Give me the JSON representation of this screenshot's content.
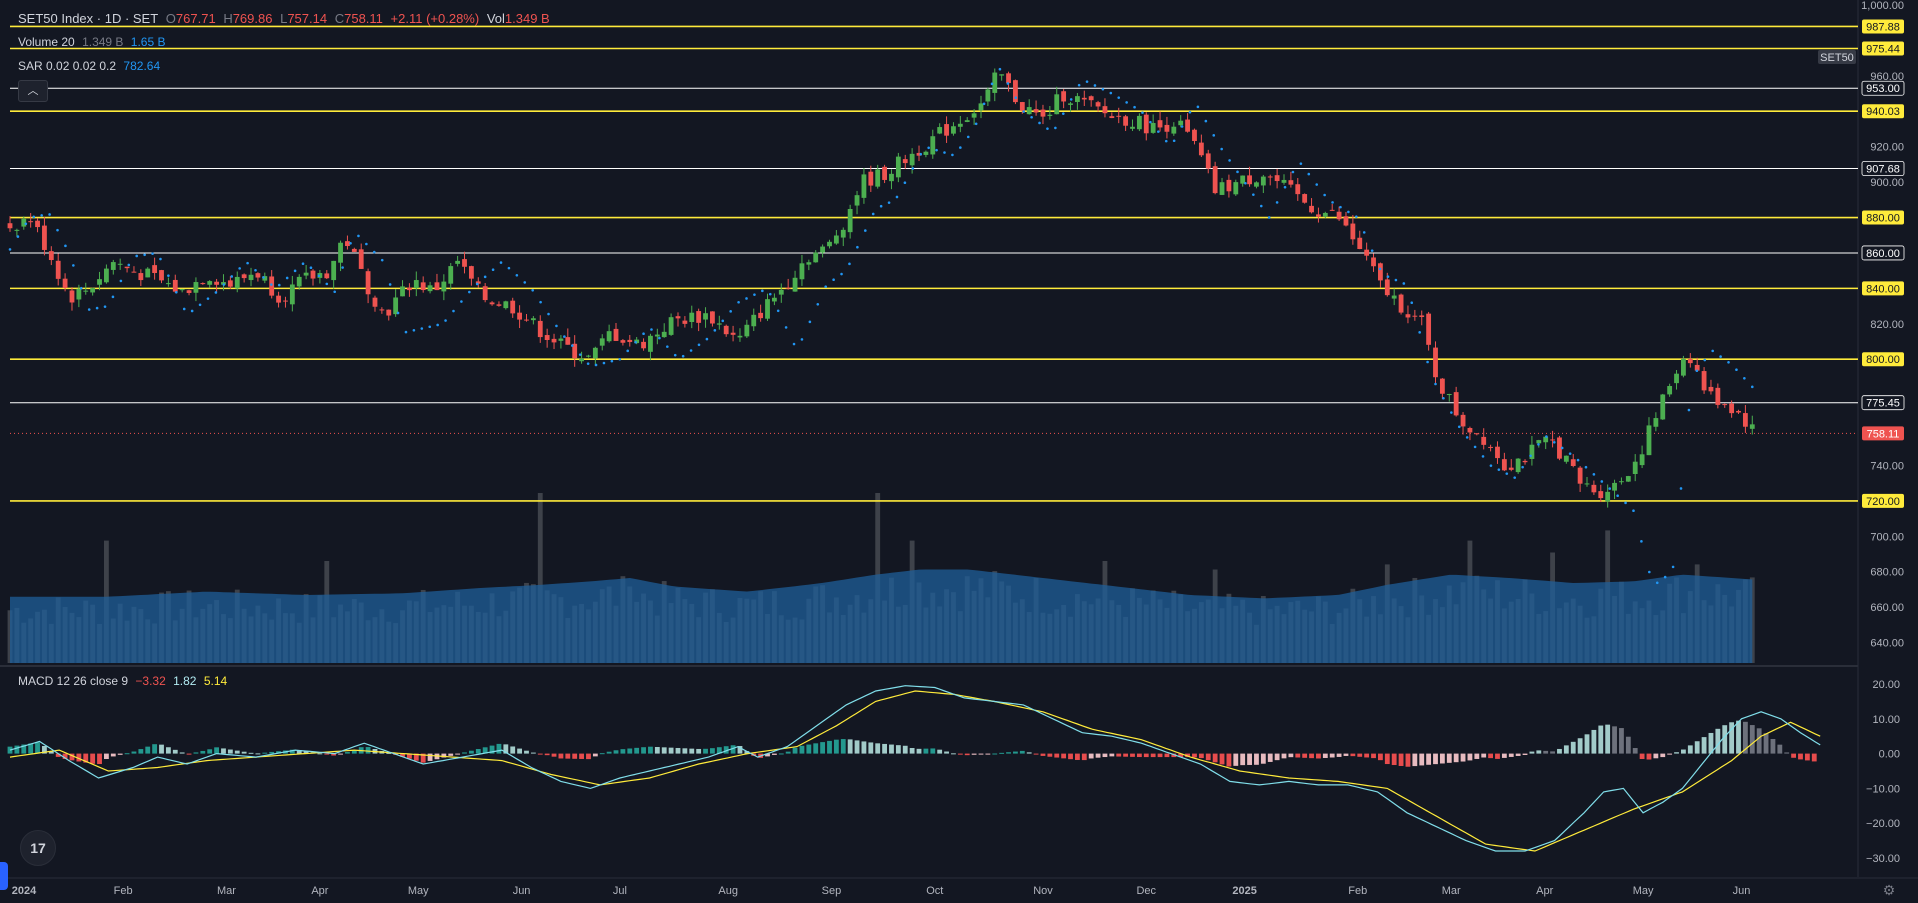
{
  "legend": {
    "symbol": "SET50 Index · 1D · SET",
    "o_label": "O",
    "o_value": "767.71",
    "h_label": "H",
    "h_value": "769.86",
    "l_label": "L",
    "l_value": "757.14",
    "c_label": "C",
    "c_value": "758.11",
    "change": "+2.11 (+0.28%)",
    "vol_label": "Vol",
    "vol_value": "1.349 B"
  },
  "volume_legend": {
    "label": "Volume 20",
    "value1": "1.349 B",
    "value2": "1.65 B"
  },
  "sar_legend": {
    "label": "SAR 0.02 0.02 0.2",
    "value": "782.64"
  },
  "macd_legend": {
    "label": "MACD 12 26 close 9",
    "v1": "−3.32",
    "v2": "1.82",
    "v3": "5.14"
  },
  "symbol_badge": "SET50",
  "icons": {
    "collapse": "chevron-up-icon",
    "logo": "tradingview-logo-icon",
    "settings": "gear-icon"
  },
  "colors": {
    "background": "#131722",
    "up": "#4caf50",
    "down": "#ef5350",
    "sar": "#2196f3",
    "volume_up": "#5d606b",
    "volume_ma": "#1f5f99",
    "macd_line": "#80deea",
    "signal_line": "#ffeb3b",
    "hline_yellow": "#ffeb3b",
    "hline_white": "#ffffff"
  },
  "chart_data": {
    "type": "candlestick",
    "price_axis": {
      "ticks": [
        "1,000.00",
        "960.00",
        "920.00",
        "900.00",
        "820.00",
        "740.00",
        "700.00",
        "680.00",
        "660.00",
        "640.00"
      ],
      "tick_values": [
        1000,
        960,
        920,
        900,
        820,
        740,
        700,
        680,
        660,
        640
      ]
    },
    "macd_axis": {
      "ticks": [
        "20.00",
        "10.00",
        "0.00",
        "−10.00",
        "−20.00",
        "−30.00"
      ],
      "tick_values": [
        20,
        10,
        0,
        -10,
        -20,
        -30
      ]
    },
    "horizontal_lines": [
      {
        "value": 987.88,
        "label": "987.88",
        "color": "yellow"
      },
      {
        "value": 975.44,
        "label": "975.44",
        "color": "yellow"
      },
      {
        "value": 953.0,
        "label": "953.00",
        "color": "white"
      },
      {
        "value": 940.03,
        "label": "940.03",
        "color": "yellow"
      },
      {
        "value": 907.68,
        "label": "907.68",
        "color": "white"
      },
      {
        "value": 880.0,
        "label": "880.00",
        "color": "yellow"
      },
      {
        "value": 860.0,
        "label": "860.00",
        "color": "white"
      },
      {
        "value": 840.0,
        "label": "840.00",
        "color": "yellow"
      },
      {
        "value": 800.0,
        "label": "800.00",
        "color": "yellow"
      },
      {
        "value": 775.45,
        "label": "775.45",
        "color": "white"
      },
      {
        "value": 720.0,
        "label": "720.00",
        "color": "yellow"
      }
    ],
    "last_price": {
      "value": 758.11,
      "label": "758.11"
    },
    "x_labels": [
      "2024",
      "Feb",
      "Mar",
      "Apr",
      "May",
      "Jun",
      "Jul",
      "Aug",
      "Sep",
      "Oct",
      "Nov",
      "Dec",
      "2025",
      "Feb",
      "Mar",
      "Apr",
      "May",
      "Jun"
    ],
    "x_label_days": [
      0,
      23,
      44,
      63,
      83,
      104,
      124,
      146,
      167,
      188,
      210,
      231,
      251,
      274,
      293,
      312,
      332,
      352
    ],
    "close_keypoints": [
      [
        0,
        875
      ],
      [
        4,
        880
      ],
      [
        8,
        860
      ],
      [
        12,
        835
      ],
      [
        16,
        840
      ],
      [
        21,
        855
      ],
      [
        25,
        850
      ],
      [
        30,
        845
      ],
      [
        35,
        838
      ],
      [
        40,
        848
      ],
      [
        45,
        842
      ],
      [
        50,
        850
      ],
      [
        55,
        835
      ],
      [
        60,
        845
      ],
      [
        65,
        850
      ],
      [
        68,
        870
      ],
      [
        72,
        845
      ],
      [
        76,
        825
      ],
      [
        82,
        845
      ],
      [
        86,
        838
      ],
      [
        91,
        855
      ],
      [
        96,
        835
      ],
      [
        102,
        830
      ],
      [
        107,
        818
      ],
      [
        112,
        808
      ],
      [
        118,
        800
      ],
      [
        122,
        815
      ],
      [
        128,
        808
      ],
      [
        135,
        822
      ],
      [
        142,
        825
      ],
      [
        148,
        810
      ],
      [
        152,
        825
      ],
      [
        157,
        840
      ],
      [
        162,
        858
      ],
      [
        166,
        862
      ],
      [
        170,
        880
      ],
      [
        173,
        900
      ],
      [
        178,
        905
      ],
      [
        183,
        915
      ],
      [
        188,
        925
      ],
      [
        193,
        935
      ],
      [
        198,
        945
      ],
      [
        201,
        962
      ],
      [
        205,
        945
      ],
      [
        210,
        935
      ],
      [
        214,
        950
      ],
      [
        218,
        945
      ],
      [
        223,
        938
      ],
      [
        228,
        935
      ],
      [
        233,
        930
      ],
      [
        237,
        935
      ],
      [
        241,
        920
      ],
      [
        245,
        895
      ],
      [
        250,
        900
      ],
      [
        255,
        905
      ],
      [
        260,
        895
      ],
      [
        265,
        885
      ],
      [
        270,
        880
      ],
      [
        275,
        860
      ],
      [
        279,
        840
      ],
      [
        283,
        830
      ],
      [
        287,
        820
      ],
      [
        290,
        790
      ],
      [
        295,
        765
      ],
      [
        300,
        755
      ],
      [
        304,
        740
      ],
      [
        308,
        745
      ],
      [
        313,
        755
      ],
      [
        316,
        745
      ],
      [
        319,
        730
      ],
      [
        323,
        725
      ],
      [
        327,
        730
      ],
      [
        331,
        745
      ],
      [
        335,
        770
      ],
      [
        338,
        790
      ],
      [
        341,
        805
      ],
      [
        345,
        780
      ],
      [
        349,
        775
      ],
      [
        352,
        768
      ],
      [
        355,
        758
      ]
    ],
    "sar_keypoints": [
      [
        0,
        862
      ],
      [
        4,
        880
      ],
      [
        8,
        882
      ],
      [
        12,
        860
      ],
      [
        16,
        828
      ],
      [
        20,
        830
      ],
      [
        25,
        858
      ],
      [
        30,
        860
      ],
      [
        36,
        825
      ],
      [
        42,
        838
      ],
      [
        48,
        855
      ],
      [
        54,
        840
      ],
      [
        60,
        855
      ],
      [
        66,
        838
      ],
      [
        70,
        872
      ],
      [
        76,
        855
      ],
      [
        80,
        815
      ],
      [
        88,
        820
      ],
      [
        94,
        840
      ],
      [
        100,
        855
      ],
      [
        106,
        840
      ],
      [
        112,
        815
      ],
      [
        118,
        796
      ],
      [
        124,
        800
      ],
      [
        130,
        818
      ],
      [
        136,
        800
      ],
      [
        142,
        812
      ],
      [
        148,
        832
      ],
      [
        154,
        840
      ],
      [
        160,
        805
      ],
      [
        166,
        842
      ],
      [
        170,
        850
      ],
      [
        176,
        885
      ],
      [
        180,
        890
      ],
      [
        186,
        920
      ],
      [
        192,
        915
      ],
      [
        196,
        930
      ],
      [
        201,
        965
      ],
      [
        206,
        940
      ],
      [
        212,
        928
      ],
      [
        218,
        958
      ],
      [
        224,
        950
      ],
      [
        230,
        940
      ],
      [
        236,
        920
      ],
      [
        241,
        945
      ],
      [
        246,
        920
      ],
      [
        251,
        900
      ],
      [
        256,
        880
      ],
      [
        262,
        912
      ],
      [
        268,
        890
      ],
      [
        274,
        880
      ],
      [
        279,
        848
      ],
      [
        284,
        842
      ],
      [
        289,
        790
      ],
      [
        295,
        760
      ],
      [
        301,
        740
      ],
      [
        306,
        733
      ],
      [
        312,
        757
      ],
      [
        318,
        745
      ],
      [
        324,
        730
      ],
      [
        330,
        715
      ],
      [
        334,
        672
      ],
      [
        338,
        680
      ],
      [
        342,
        790
      ],
      [
        346,
        805
      ],
      [
        350,
        797
      ],
      [
        355,
        782
      ]
    ],
    "volume_ma_keypoints": [
      [
        0,
        0.39
      ],
      [
        20,
        0.39
      ],
      [
        40,
        0.42
      ],
      [
        60,
        0.4
      ],
      [
        80,
        0.41
      ],
      [
        95,
        0.44
      ],
      [
        108,
        0.46
      ],
      [
        118,
        0.48
      ],
      [
        126,
        0.5
      ],
      [
        135,
        0.45
      ],
      [
        150,
        0.42
      ],
      [
        165,
        0.47
      ],
      [
        176,
        0.52
      ],
      [
        185,
        0.55
      ],
      [
        195,
        0.55
      ],
      [
        210,
        0.5
      ],
      [
        225,
        0.45
      ],
      [
        240,
        0.4
      ],
      [
        255,
        0.38
      ],
      [
        270,
        0.4
      ],
      [
        280,
        0.46
      ],
      [
        293,
        0.52
      ],
      [
        305,
        0.5
      ],
      [
        318,
        0.47
      ],
      [
        330,
        0.48
      ],
      [
        340,
        0.52
      ],
      [
        350,
        0.5
      ],
      [
        355,
        0.49
      ]
    ],
    "volume_spikes": [
      [
        19,
        0.72
      ],
      [
        65,
        0.6
      ],
      [
        108,
        1.0
      ],
      [
        126,
        0.45
      ],
      [
        176,
        1.0
      ],
      [
        183,
        0.72
      ],
      [
        222,
        0.6
      ],
      [
        245,
        0.55
      ],
      [
        280,
        0.58
      ],
      [
        297,
        0.72
      ],
      [
        313,
        0.65
      ],
      [
        325,
        0.78
      ],
      [
        343,
        0.58
      ]
    ],
    "macd_keypoints": [
      [
        0,
        1
      ],
      [
        6,
        3.5
      ],
      [
        12,
        -2
      ],
      [
        18,
        -7
      ],
      [
        25,
        -4
      ],
      [
        30,
        -1
      ],
      [
        36,
        -3
      ],
      [
        42,
        0
      ],
      [
        50,
        -1
      ],
      [
        58,
        1
      ],
      [
        66,
        0
      ],
      [
        72,
        3
      ],
      [
        78,
        0
      ],
      [
        84,
        -3
      ],
      [
        92,
        -1
      ],
      [
        100,
        1
      ],
      [
        106,
        -4
      ],
      [
        112,
        -8
      ],
      [
        118,
        -10
      ],
      [
        124,
        -7
      ],
      [
        130,
        -5
      ],
      [
        136,
        -3
      ],
      [
        142,
        -1
      ],
      [
        148,
        2
      ],
      [
        152,
        -1
      ],
      [
        158,
        2
      ],
      [
        164,
        8
      ],
      [
        170,
        14
      ],
      [
        176,
        18
      ],
      [
        182,
        19.5
      ],
      [
        188,
        19
      ],
      [
        194,
        16
      ],
      [
        200,
        15
      ],
      [
        206,
        14
      ],
      [
        212,
        10
      ],
      [
        218,
        6
      ],
      [
        224,
        5
      ],
      [
        230,
        3
      ],
      [
        236,
        0
      ],
      [
        242,
        -3
      ],
      [
        248,
        -8
      ],
      [
        254,
        -9
      ],
      [
        260,
        -8
      ],
      [
        266,
        -9
      ],
      [
        272,
        -9
      ],
      [
        278,
        -11
      ],
      [
        284,
        -17
      ],
      [
        290,
        -21
      ],
      [
        296,
        -25
      ],
      [
        302,
        -28
      ],
      [
        308,
        -28
      ],
      [
        314,
        -25
      ],
      [
        320,
        -17
      ],
      [
        324,
        -11
      ],
      [
        328,
        -10
      ],
      [
        332,
        -17
      ],
      [
        336,
        -14
      ],
      [
        340,
        -10
      ],
      [
        344,
        -3
      ],
      [
        348,
        4
      ],
      [
        352,
        10
      ],
      [
        356,
        12
      ],
      [
        360,
        10
      ],
      [
        364,
        6
      ],
      [
        368,
        2.5
      ]
    ],
    "signal_keypoints": [
      [
        0,
        -1
      ],
      [
        10,
        1
      ],
      [
        20,
        -5
      ],
      [
        30,
        -4
      ],
      [
        40,
        -2
      ],
      [
        50,
        -1
      ],
      [
        60,
        0
      ],
      [
        70,
        1
      ],
      [
        80,
        0
      ],
      [
        90,
        -1
      ],
      [
        100,
        -2
      ],
      [
        110,
        -6
      ],
      [
        120,
        -9
      ],
      [
        130,
        -7
      ],
      [
        140,
        -3
      ],
      [
        150,
        0
      ],
      [
        160,
        2
      ],
      [
        168,
        8
      ],
      [
        176,
        15
      ],
      [
        184,
        18
      ],
      [
        192,
        17
      ],
      [
        200,
        15
      ],
      [
        210,
        12
      ],
      [
        220,
        7
      ],
      [
        230,
        4
      ],
      [
        240,
        -1
      ],
      [
        250,
        -5
      ],
      [
        260,
        -7
      ],
      [
        270,
        -8
      ],
      [
        280,
        -10
      ],
      [
        290,
        -18
      ],
      [
        300,
        -26
      ],
      [
        310,
        -28
      ],
      [
        320,
        -22
      ],
      [
        330,
        -16
      ],
      [
        340,
        -11
      ],
      [
        350,
        -2
      ],
      [
        356,
        5
      ],
      [
        362,
        9
      ],
      [
        368,
        5
      ]
    ]
  }
}
